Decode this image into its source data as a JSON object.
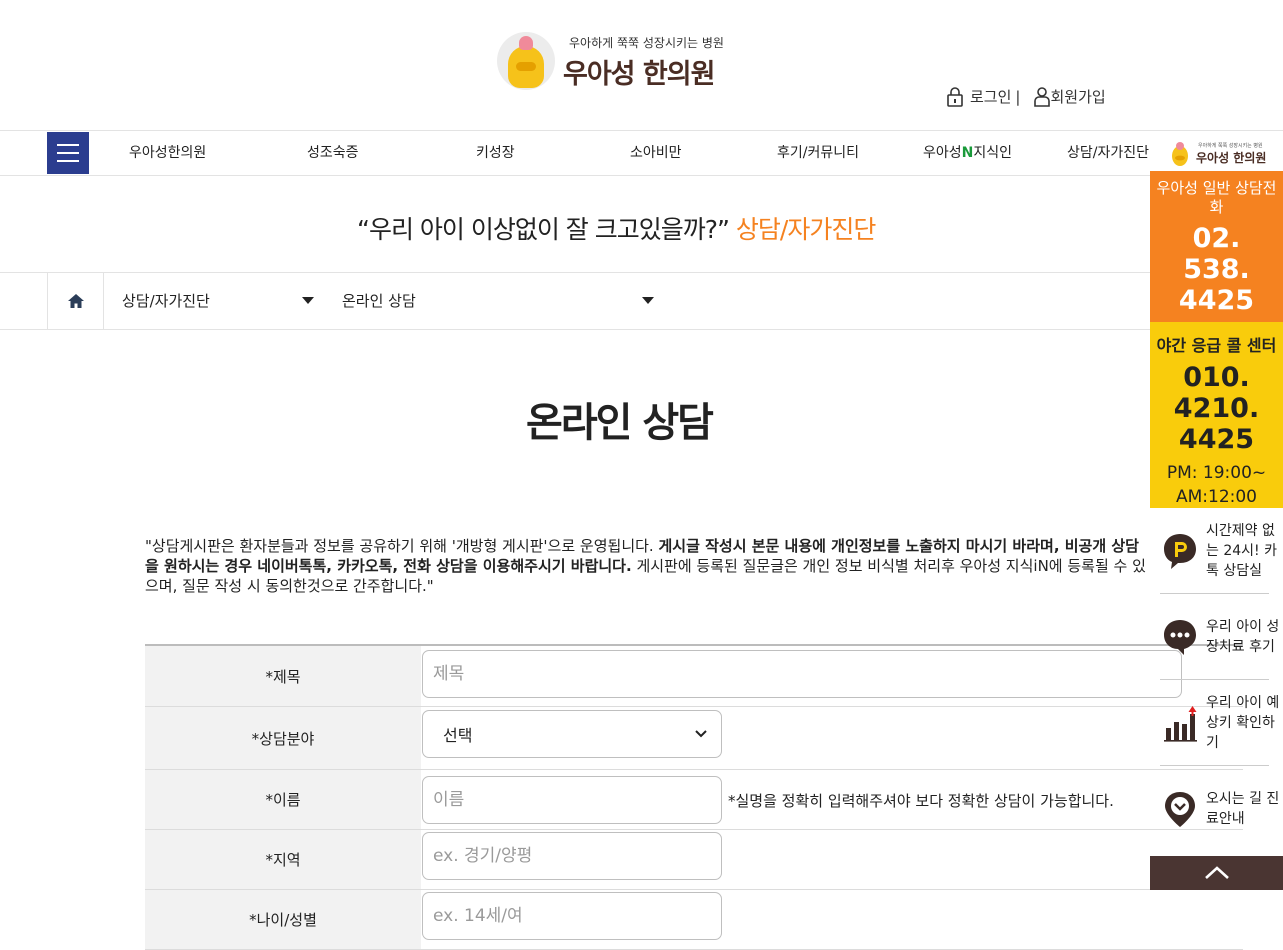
{
  "header": {
    "tagline": "우아하게 쭉쭉 성장시키는 병원",
    "brand_name": "우아성 한의원",
    "login_label": "로그인",
    "separator": "|",
    "signup_label": "회원가입"
  },
  "nav": {
    "items": [
      "우아성한의원",
      "성조숙증",
      "키성장",
      "소아비만",
      "후기/커뮤니티",
      "지식인",
      "상담/자가진단"
    ],
    "item_prefix_6": "우아성",
    "item_n_6": "N",
    "mini_logo_tagline": "우아하게 쭉쭉 성장시키는 병원",
    "mini_logo_name": "우아성 한의원"
  },
  "banner": {
    "quote": "“우리 아이 이상없이 잘 크고있을까?”",
    "highlight": "상담/자가진단"
  },
  "breadcrumb": {
    "level1": "상담/자가진단",
    "level2": "온라인 상담"
  },
  "page": {
    "title": "온라인 상담",
    "notice_part1": "\"상담게시판은 환자분들과 정보를 공유하기 위해 '개방형 게시판'으로 운영됩니다. ",
    "notice_bold": "게시글 작성시 본문 내용에 개인정보를 노출하지 마시기 바라며, 비공개 상담을 원하시는 경우 네이버톡톡, 카카오톡, 전화 상담을 이용해주시기 바랍니다.",
    "notice_part2": " 게시판에 등록된 질문글은 개인 정보 비식별 처리후 우아성 지식iN에 등록될 수 있으며, 질문 작성 시 동의한것으로 간주합니다.\""
  },
  "form": {
    "title_label": "*제목",
    "title_placeholder": "제목",
    "category_label": "*상담분야",
    "category_value": "선택",
    "name_label": "*이름",
    "name_placeholder": "이름",
    "name_hint": "*실명을 정확히 입력해주셔야 보다 정확한 상담이 가능합니다.",
    "region_label": "*지역",
    "region_placeholder": "ex. 경기/양평",
    "age_label": "*나이/성별",
    "age_placeholder": "ex. 14세/여"
  },
  "side": {
    "general_title": "우아성 일반 상담전화",
    "general_phone_1": "02.",
    "general_phone_2": "538.",
    "general_phone_3": "4425",
    "night_title": "야간 응급 콜 센터",
    "night_phone_1": "010.",
    "night_phone_2": "4210.",
    "night_phone_3": "4425",
    "night_hours_1": "PM: 19:00~",
    "night_hours_2": "AM:12:00",
    "items": [
      {
        "label": "시간제약 없는 24시! 카톡 상담실",
        "icon": "kakao-talk-icon"
      },
      {
        "label": "우리 아이 성장치료 후기",
        "icon": "speech-bubble-icon"
      },
      {
        "label": "우리 아이 예상키 확인하기",
        "icon": "growth-chart-icon"
      },
      {
        "label": "오시는 길 진료안내",
        "icon": "location-pin-icon"
      }
    ]
  },
  "colors": {
    "nav_menu_blue": "#2b3d8f",
    "orange": "#f58220",
    "yellow": "#f9cc0c",
    "brown": "#4a3532"
  }
}
